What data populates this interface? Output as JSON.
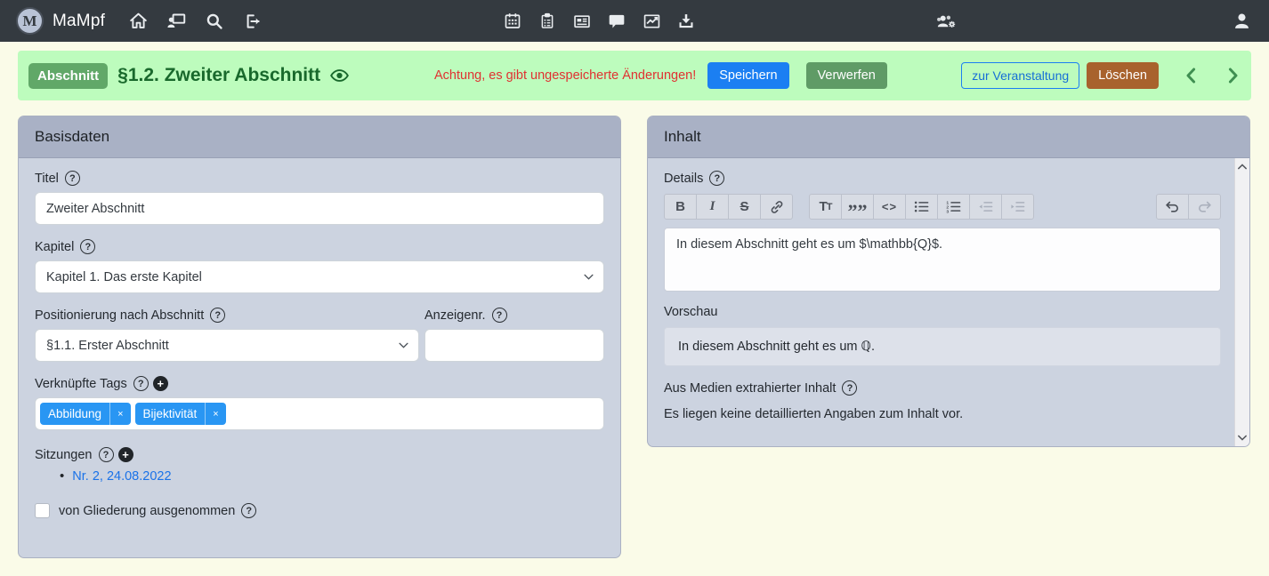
{
  "navbar": {
    "brand": "MaMpf",
    "logo_letter": "M",
    "left_icons": [
      "home-icon",
      "screen-user-icon",
      "search-icon",
      "sign-out-icon"
    ],
    "center_icons": [
      "calendar-icon",
      "clipboard-list-icon",
      "newspaper-icon",
      "comment-icon",
      "chart-line-icon",
      "download-icon"
    ],
    "right_icons": [
      "users-gear-icon",
      "user-icon"
    ]
  },
  "alert": {
    "badge": "Abschnitt",
    "title": "§1.2. Zweiter Abschnitt",
    "title_icon": "eye-icon",
    "warning": "Achtung, es gibt ungespeicherte Änderungen!",
    "save_label": "Speichern",
    "discard_label": "Verwerfen",
    "to_event_label": "zur Veranstaltung",
    "delete_label": "Löschen",
    "nav_icons": [
      "chevron-left-icon",
      "chevron-right-icon"
    ]
  },
  "basisdaten": {
    "title": "Basisdaten",
    "titel_label": "Titel",
    "titel_value": "Zweiter Abschnitt",
    "kapitel_label": "Kapitel",
    "kapitel_value": "Kapitel 1. Das erste Kapitel",
    "position_label": "Positionierung nach Abschnitt",
    "position_value": "§1.1. Erster Abschnitt",
    "anzeigenr_label": "Anzeigenr.",
    "anzeigenr_value": "",
    "tags_label": "Verknüpfte Tags",
    "tags": [
      {
        "label": "Abbildung",
        "remove": "×"
      },
      {
        "label": "Bijektivität",
        "remove": "×"
      }
    ],
    "sitzungen_label": "Sitzungen",
    "sitzungen": [
      {
        "label": "Nr. 2, 24.08.2022"
      }
    ],
    "checkbox_label": "von Gliederung ausgenommen",
    "checkbox_checked": false
  },
  "inhalt": {
    "title": "Inhalt",
    "details_label": "Details",
    "editor_value": "In diesem Abschnitt geht es um $\\mathbb{Q}$.",
    "vorschau_label": "Vorschau",
    "vorschau_prefix": "In diesem Abschnitt geht es um ",
    "vorschau_math": "ℚ",
    "vorschau_suffix": ".",
    "extracted_label": "Aus Medien extrahierter Inhalt",
    "extracted_empty": "Es liegen keine detaillierten Angaben zum Inhalt vor.",
    "toolbar": {
      "glyphs": {
        "bold": "B",
        "italic": "I",
        "strike": "S",
        "quote": "”",
        "code": "<>",
        "heading_big": "T",
        "heading_small": "T"
      },
      "groups": [
        {
          "buttons": [
            {
              "name": "bold",
              "enabled": true
            },
            {
              "name": "italic",
              "enabled": true
            },
            {
              "name": "strike",
              "enabled": true
            },
            {
              "name": "link",
              "enabled": true
            }
          ]
        },
        {
          "buttons": [
            {
              "name": "heading",
              "enabled": true
            },
            {
              "name": "quote",
              "enabled": true
            },
            {
              "name": "code",
              "enabled": true
            },
            {
              "name": "bullet-list",
              "enabled": true
            },
            {
              "name": "number-list",
              "enabled": true
            },
            {
              "name": "outdent",
              "enabled": false
            },
            {
              "name": "indent",
              "enabled": false
            }
          ]
        },
        {
          "buttons": [
            {
              "name": "undo",
              "enabled": true
            },
            {
              "name": "redo",
              "enabled": false
            }
          ]
        }
      ]
    }
  },
  "colors": {
    "navbar_bg": "#343a40",
    "page_bg": "#fafbe8",
    "alert_bg": "#bdfcbd",
    "badge_green": "#61a868",
    "title_green": "#19692c",
    "warning_red": "#e03131",
    "primary_blue": "#1b7ff2",
    "discard_green": "#5f9b66",
    "delete_brown": "#a8622d",
    "panel_header": "#a9b1c5",
    "panel_body": "#ccd3e0",
    "tag_blue": "#2996f3",
    "link_blue": "#1a72e8"
  }
}
